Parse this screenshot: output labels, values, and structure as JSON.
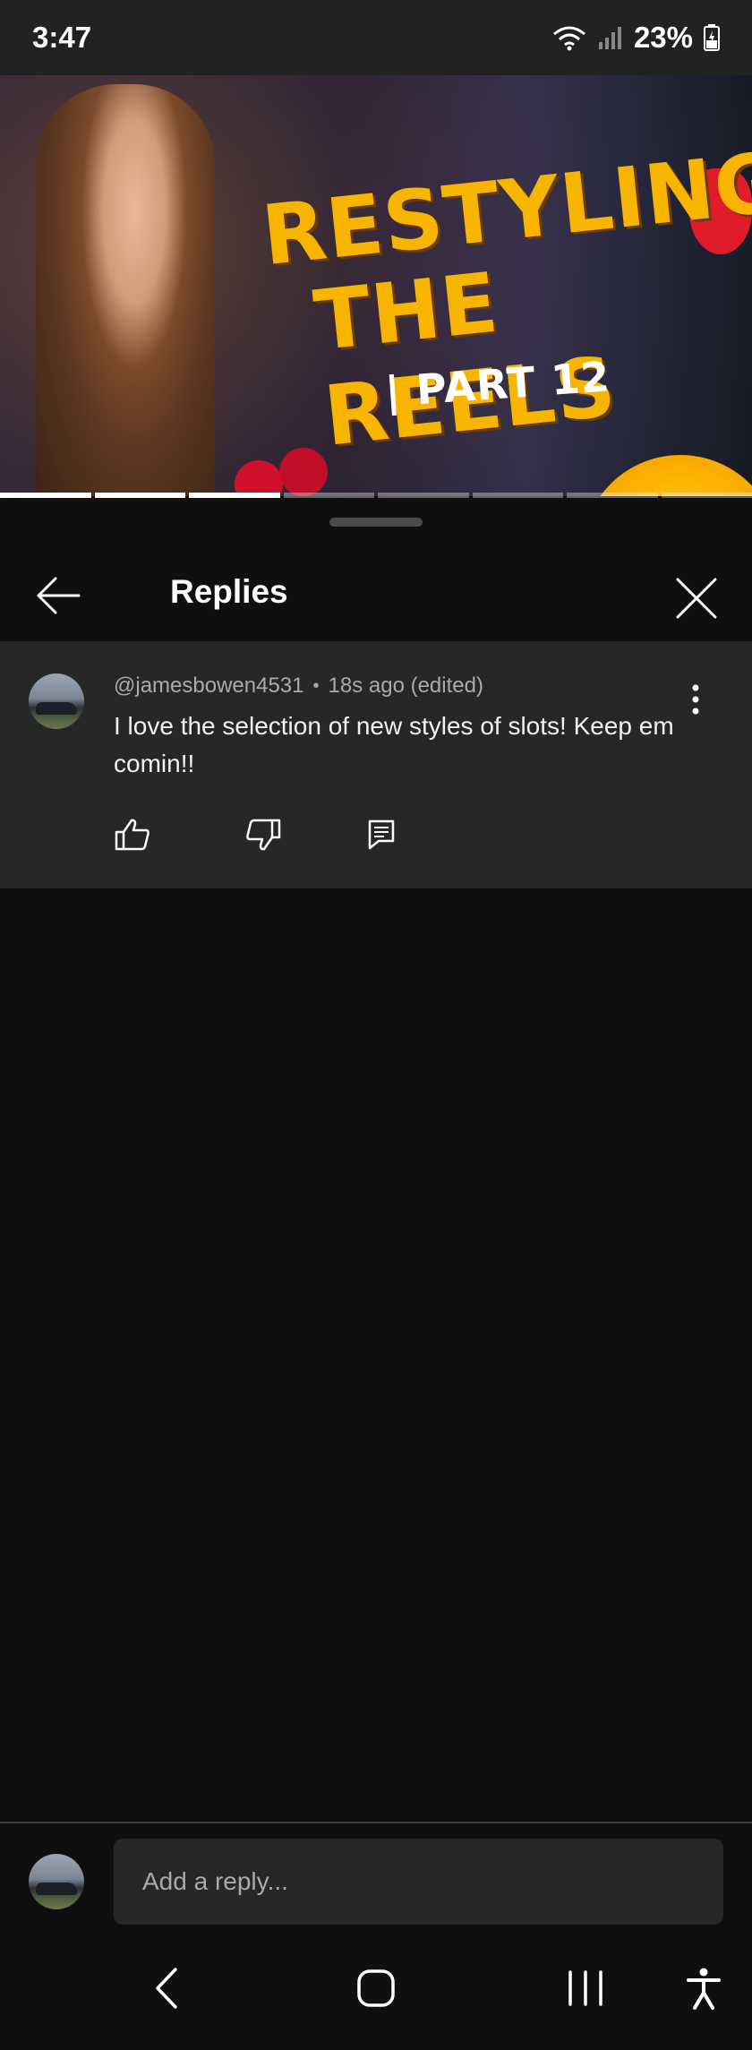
{
  "status_bar": {
    "time": "3:47",
    "battery": "23%",
    "icons": [
      "wifi-icon",
      "signal-icon",
      "battery-charging-icon"
    ]
  },
  "video": {
    "title_line_1": "RESTYLING",
    "title_line_2": "THE REELS",
    "title_line_3": "| PART 12",
    "progress_segments_total": 8,
    "progress_segments_watched": 3
  },
  "replies_sheet": {
    "title": "Replies",
    "comment": {
      "author": "@jamesbowen4531",
      "separator": "•",
      "time": "18s ago (edited)",
      "text": "I love the selection of new styles of slots! Keep em comin!!"
    },
    "composer": {
      "placeholder": "Add a reply..."
    }
  },
  "nav_bar": {
    "icons": [
      "nav-back-icon",
      "nav-home-icon",
      "nav-recents-icon",
      "accessibility-icon"
    ]
  },
  "colors": {
    "background": "#0f0f0f",
    "card": "#272727",
    "title_yellow": "#f7b500",
    "secondary_text": "#aaaaaa"
  }
}
